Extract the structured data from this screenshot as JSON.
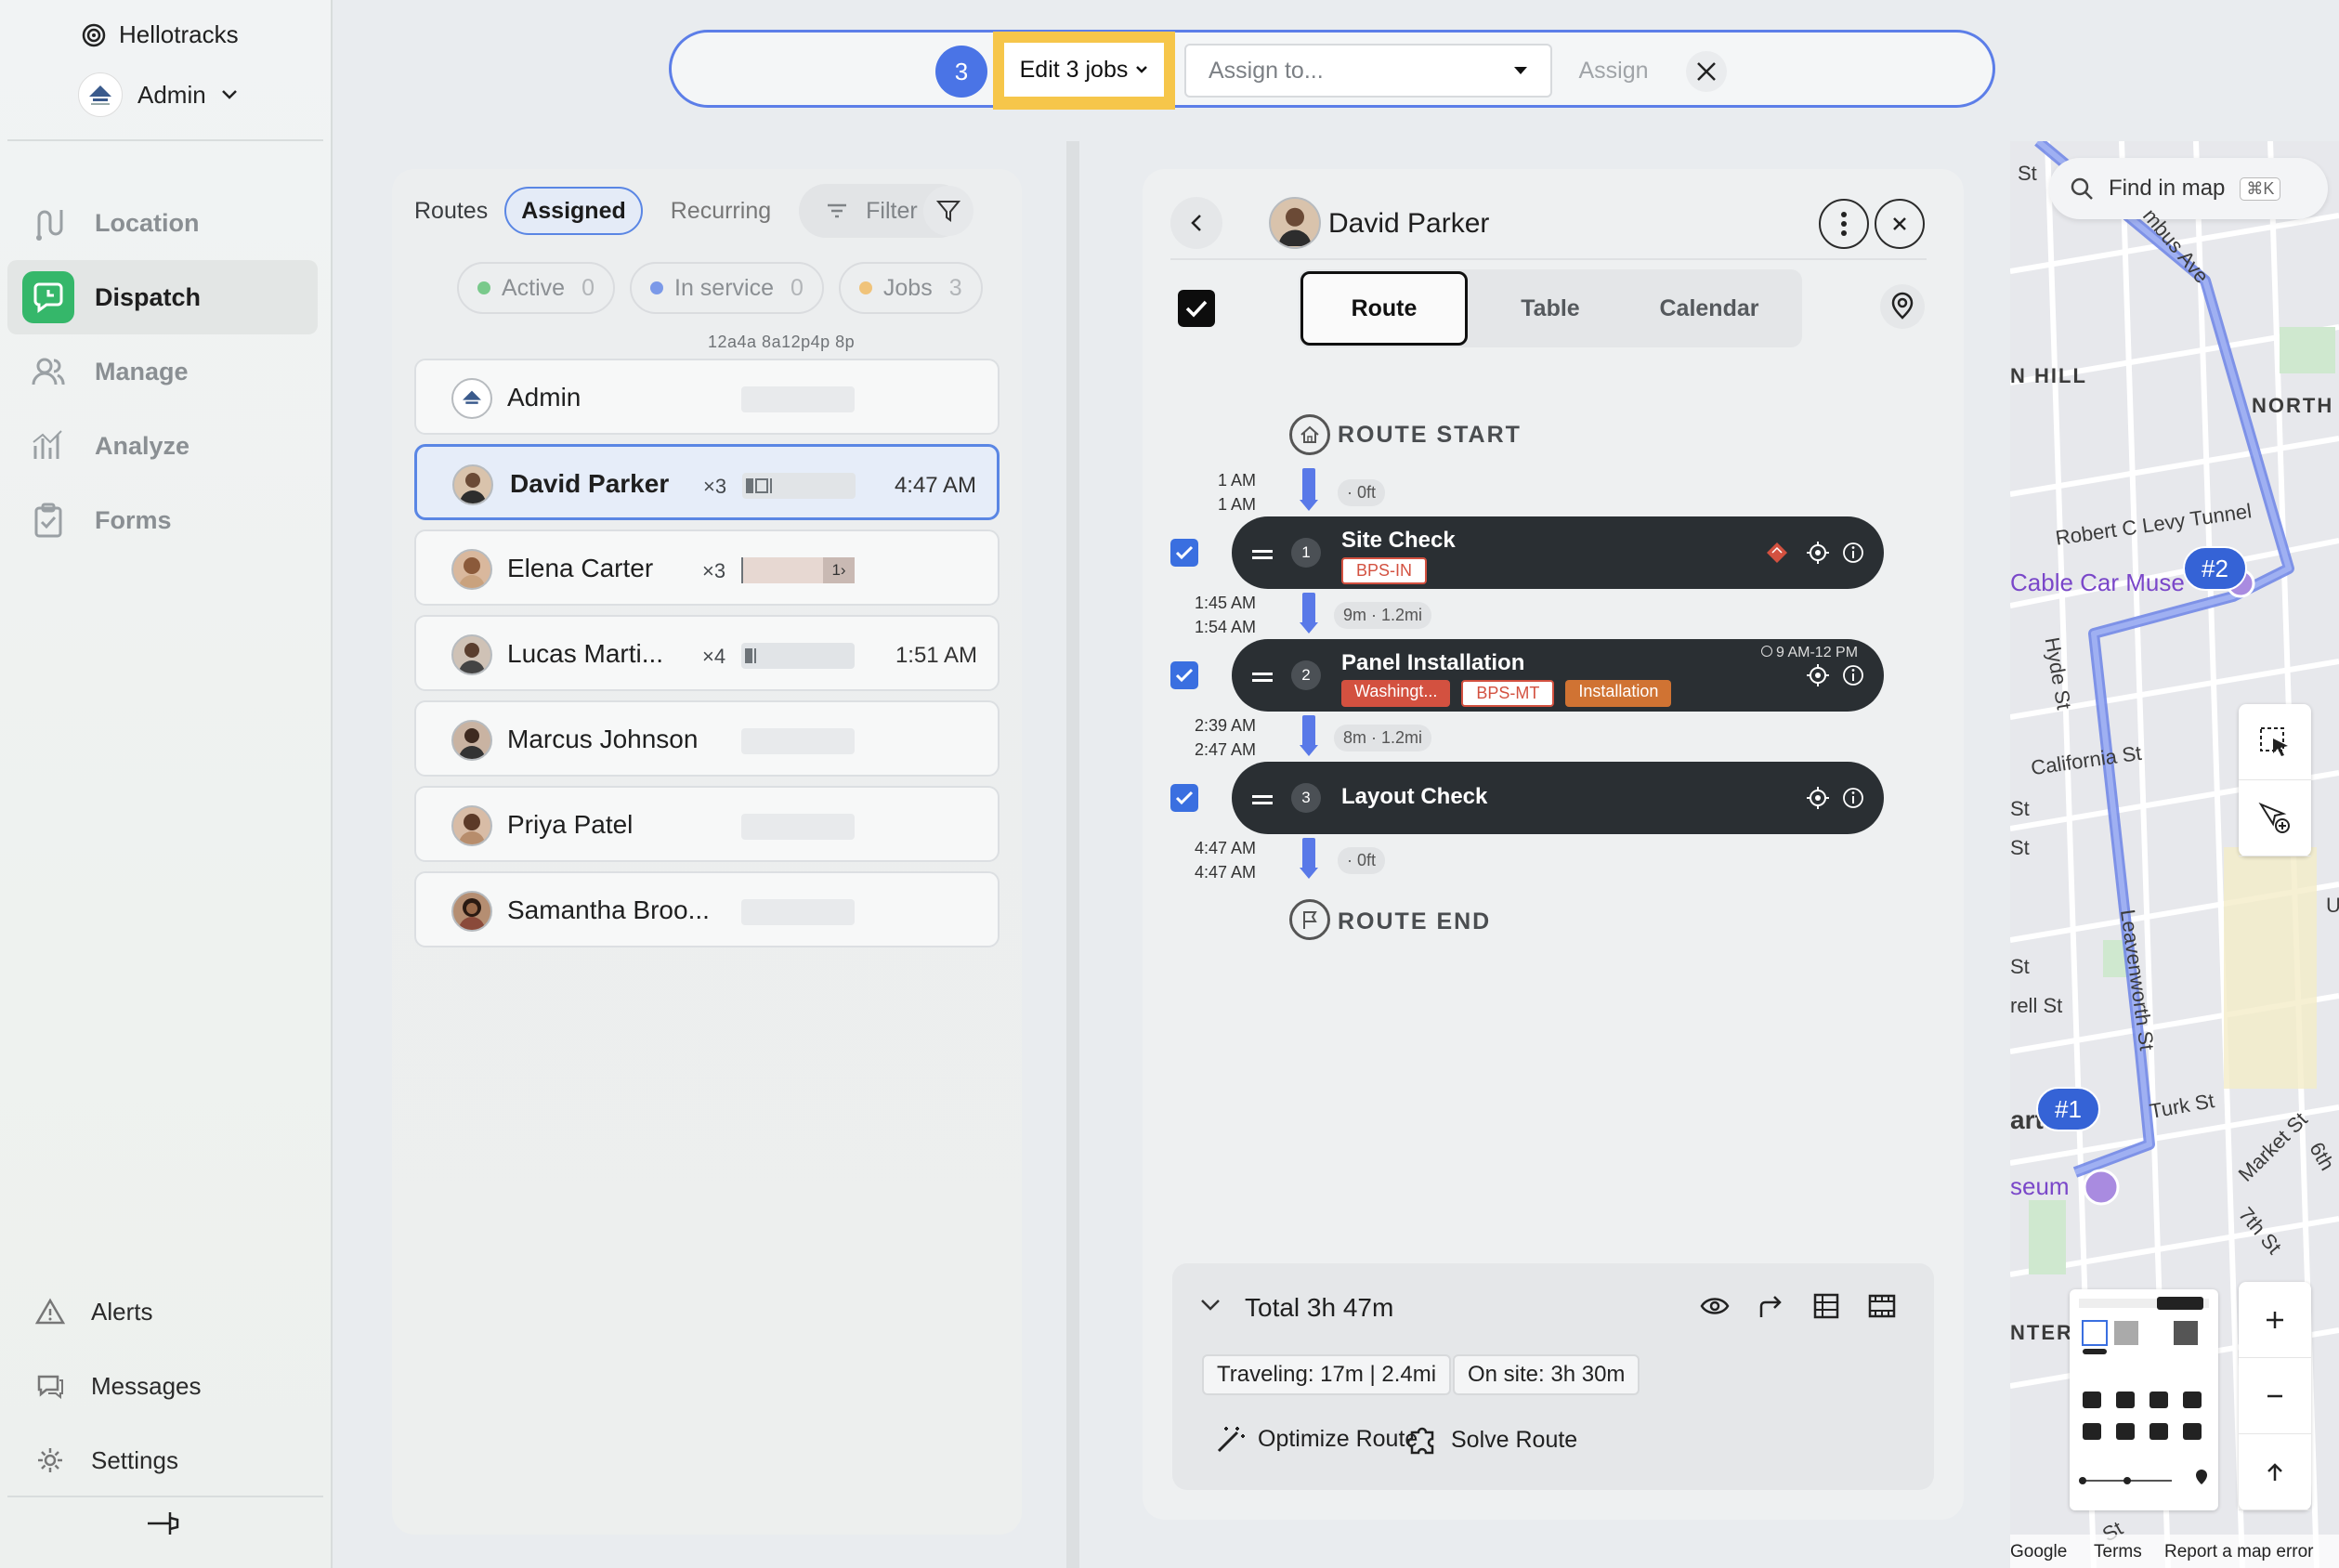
{
  "sidebar": {
    "brand": "Hellotracks",
    "org_name": "Admin",
    "nav": [
      {
        "label": "Location",
        "icon": "route-icon"
      },
      {
        "label": "Dispatch",
        "icon": "dispatch-icon"
      },
      {
        "label": "Manage",
        "icon": "people-icon"
      },
      {
        "label": "Analyze",
        "icon": "chart-icon"
      },
      {
        "label": "Forms",
        "icon": "clipboard-icon"
      }
    ],
    "bottom": [
      {
        "label": "Alerts",
        "icon": "warning-icon"
      },
      {
        "label": "Messages",
        "icon": "chat-icon"
      },
      {
        "label": "Settings",
        "icon": "gear-icon"
      }
    ]
  },
  "topbar": {
    "selected_count": "3",
    "edit_label": "Edit 3 jobs",
    "assign_placeholder": "Assign to...",
    "assign_button": "Assign"
  },
  "routes": {
    "tabs": [
      "Routes",
      "Assigned",
      "Recurring"
    ],
    "filter_label": "Filter",
    "status": [
      {
        "label": "Active",
        "count": "0",
        "color": "#79c98b"
      },
      {
        "label": "In service",
        "count": "0",
        "color": "#7b99e8"
      },
      {
        "label": "Jobs",
        "count": "3",
        "color": "#f0c37a"
      }
    ],
    "time_axis": "12a4a 8a12p4p 8p",
    "drivers": [
      {
        "name": "Admin",
        "count": "",
        "time": ""
      },
      {
        "name": "David Parker",
        "count": "×3",
        "time": "4:47 AM"
      },
      {
        "name": "Elena Carter",
        "count": "×3",
        "time": "",
        "bar_label": "1›"
      },
      {
        "name": "Lucas Marti...",
        "count": "×4",
        "time": "1:51 AM"
      },
      {
        "name": "Marcus Johnson",
        "count": "",
        "time": ""
      },
      {
        "name": "Priya Patel",
        "count": "",
        "time": ""
      },
      {
        "name": "Samantha Broo...",
        "count": "",
        "time": ""
      }
    ]
  },
  "detail": {
    "driver_name": "David Parker",
    "tabs": [
      "Route",
      "Table",
      "Calendar"
    ],
    "route_start": "ROUTE START",
    "route_end": "ROUTE END",
    "legs": [
      {
        "times": [
          "1 AM",
          "1 AM"
        ],
        "dist": "· 0ft"
      },
      {
        "times": [
          "1:45 AM",
          "1:54 AM"
        ],
        "dist": "9m · 1.2mi"
      },
      {
        "times": [
          "2:39 AM",
          "2:47 AM"
        ],
        "dist": "8m · 1.2mi"
      },
      {
        "times": [
          "4:47 AM",
          "4:47 AM"
        ],
        "dist": "· 0ft"
      }
    ],
    "jobs": [
      {
        "num": "1",
        "title": "Site Check",
        "tags": [
          "BPS-IN"
        ],
        "window": ""
      },
      {
        "num": "2",
        "title": "Panel Installation",
        "tags": [
          "Washingt...",
          "BPS-MT",
          "Installation"
        ],
        "window": "9 AM-12 PM"
      },
      {
        "num": "3",
        "title": "Layout Check",
        "tags": [],
        "window": ""
      }
    ],
    "summary": {
      "total": "Total 3h 47m",
      "traveling": "Traveling: 17m | 2.4mi",
      "on_site": "On site: 3h 30m",
      "optimize": "Optimize Route",
      "solve": "Solve Route"
    }
  },
  "map": {
    "search_placeholder": "Find in map",
    "shortcut": "⌘K",
    "labels": [
      "St",
      "mbus Ave",
      "N HILL",
      "NORTH",
      "Robert C Levy Tunnel",
      "Cable Car Muse",
      "Hyde St",
      "California St",
      "St",
      "St",
      "St",
      "rell St",
      "Leavenworth St",
      "art",
      "Turk St",
      "seum",
      "Market St",
      "6th",
      "7th St",
      "NTER",
      "St",
      "U"
    ],
    "markers": [
      "#2",
      "#1"
    ],
    "attribution": [
      "Google",
      "Terms",
      "Report a map error"
    ]
  }
}
